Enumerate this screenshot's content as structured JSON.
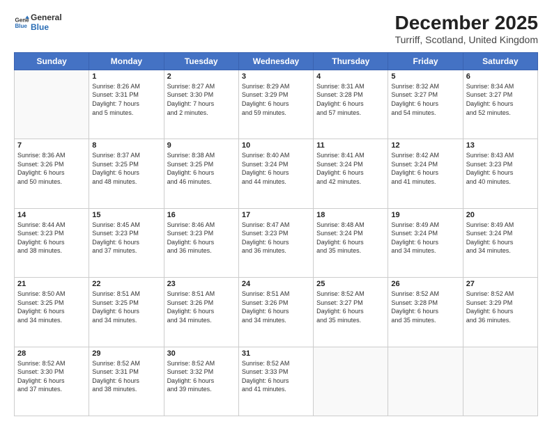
{
  "logo": {
    "line1": "General",
    "line2": "Blue"
  },
  "title": "December 2025",
  "subtitle": "Turriff, Scotland, United Kingdom",
  "days_of_week": [
    "Sunday",
    "Monday",
    "Tuesday",
    "Wednesday",
    "Thursday",
    "Friday",
    "Saturday"
  ],
  "weeks": [
    [
      {
        "day": "",
        "info": ""
      },
      {
        "day": "1",
        "info": "Sunrise: 8:26 AM\nSunset: 3:31 PM\nDaylight: 7 hours\nand 5 minutes."
      },
      {
        "day": "2",
        "info": "Sunrise: 8:27 AM\nSunset: 3:30 PM\nDaylight: 7 hours\nand 2 minutes."
      },
      {
        "day": "3",
        "info": "Sunrise: 8:29 AM\nSunset: 3:29 PM\nDaylight: 6 hours\nand 59 minutes."
      },
      {
        "day": "4",
        "info": "Sunrise: 8:31 AM\nSunset: 3:28 PM\nDaylight: 6 hours\nand 57 minutes."
      },
      {
        "day": "5",
        "info": "Sunrise: 8:32 AM\nSunset: 3:27 PM\nDaylight: 6 hours\nand 54 minutes."
      },
      {
        "day": "6",
        "info": "Sunrise: 8:34 AM\nSunset: 3:27 PM\nDaylight: 6 hours\nand 52 minutes."
      }
    ],
    [
      {
        "day": "7",
        "info": "Sunrise: 8:36 AM\nSunset: 3:26 PM\nDaylight: 6 hours\nand 50 minutes."
      },
      {
        "day": "8",
        "info": "Sunrise: 8:37 AM\nSunset: 3:25 PM\nDaylight: 6 hours\nand 48 minutes."
      },
      {
        "day": "9",
        "info": "Sunrise: 8:38 AM\nSunset: 3:25 PM\nDaylight: 6 hours\nand 46 minutes."
      },
      {
        "day": "10",
        "info": "Sunrise: 8:40 AM\nSunset: 3:24 PM\nDaylight: 6 hours\nand 44 minutes."
      },
      {
        "day": "11",
        "info": "Sunrise: 8:41 AM\nSunset: 3:24 PM\nDaylight: 6 hours\nand 42 minutes."
      },
      {
        "day": "12",
        "info": "Sunrise: 8:42 AM\nSunset: 3:24 PM\nDaylight: 6 hours\nand 41 minutes."
      },
      {
        "day": "13",
        "info": "Sunrise: 8:43 AM\nSunset: 3:23 PM\nDaylight: 6 hours\nand 40 minutes."
      }
    ],
    [
      {
        "day": "14",
        "info": "Sunrise: 8:44 AM\nSunset: 3:23 PM\nDaylight: 6 hours\nand 38 minutes."
      },
      {
        "day": "15",
        "info": "Sunrise: 8:45 AM\nSunset: 3:23 PM\nDaylight: 6 hours\nand 37 minutes."
      },
      {
        "day": "16",
        "info": "Sunrise: 8:46 AM\nSunset: 3:23 PM\nDaylight: 6 hours\nand 36 minutes."
      },
      {
        "day": "17",
        "info": "Sunrise: 8:47 AM\nSunset: 3:23 PM\nDaylight: 6 hours\nand 36 minutes."
      },
      {
        "day": "18",
        "info": "Sunrise: 8:48 AM\nSunset: 3:24 PM\nDaylight: 6 hours\nand 35 minutes."
      },
      {
        "day": "19",
        "info": "Sunrise: 8:49 AM\nSunset: 3:24 PM\nDaylight: 6 hours\nand 34 minutes."
      },
      {
        "day": "20",
        "info": "Sunrise: 8:49 AM\nSunset: 3:24 PM\nDaylight: 6 hours\nand 34 minutes."
      }
    ],
    [
      {
        "day": "21",
        "info": "Sunrise: 8:50 AM\nSunset: 3:25 PM\nDaylight: 6 hours\nand 34 minutes."
      },
      {
        "day": "22",
        "info": "Sunrise: 8:51 AM\nSunset: 3:25 PM\nDaylight: 6 hours\nand 34 minutes."
      },
      {
        "day": "23",
        "info": "Sunrise: 8:51 AM\nSunset: 3:26 PM\nDaylight: 6 hours\nand 34 minutes."
      },
      {
        "day": "24",
        "info": "Sunrise: 8:51 AM\nSunset: 3:26 PM\nDaylight: 6 hours\nand 34 minutes."
      },
      {
        "day": "25",
        "info": "Sunrise: 8:52 AM\nSunset: 3:27 PM\nDaylight: 6 hours\nand 35 minutes."
      },
      {
        "day": "26",
        "info": "Sunrise: 8:52 AM\nSunset: 3:28 PM\nDaylight: 6 hours\nand 35 minutes."
      },
      {
        "day": "27",
        "info": "Sunrise: 8:52 AM\nSunset: 3:29 PM\nDaylight: 6 hours\nand 36 minutes."
      }
    ],
    [
      {
        "day": "28",
        "info": "Sunrise: 8:52 AM\nSunset: 3:30 PM\nDaylight: 6 hours\nand 37 minutes."
      },
      {
        "day": "29",
        "info": "Sunrise: 8:52 AM\nSunset: 3:31 PM\nDaylight: 6 hours\nand 38 minutes."
      },
      {
        "day": "30",
        "info": "Sunrise: 8:52 AM\nSunset: 3:32 PM\nDaylight: 6 hours\nand 39 minutes."
      },
      {
        "day": "31",
        "info": "Sunrise: 8:52 AM\nSunset: 3:33 PM\nDaylight: 6 hours\nand 41 minutes."
      },
      {
        "day": "",
        "info": ""
      },
      {
        "day": "",
        "info": ""
      },
      {
        "day": "",
        "info": ""
      }
    ]
  ]
}
